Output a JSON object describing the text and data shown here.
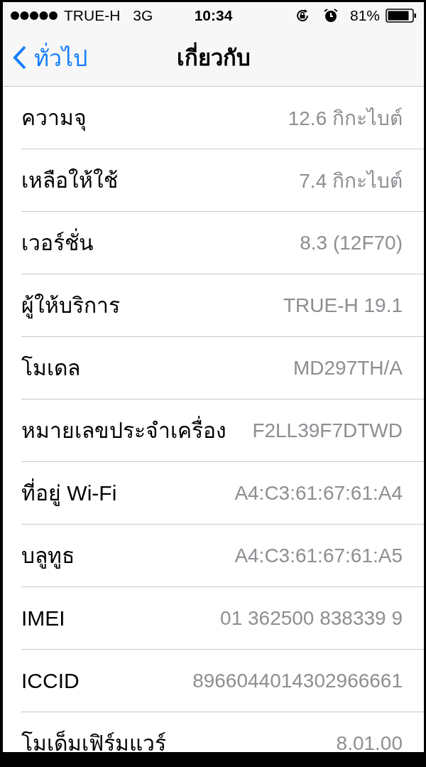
{
  "status_bar": {
    "carrier": "TRUE-H",
    "network": "3G",
    "time": "10:34",
    "battery": "81%"
  },
  "nav_bar": {
    "back": "ทั่วไป",
    "title": "เกี่ยวกับ"
  },
  "rows": [
    {
      "label": "ความจุ",
      "value": "12.6 กิกะไบต์"
    },
    {
      "label": "เหลือให้ใช้",
      "value": "7.4 กิกะไบต์"
    },
    {
      "label": "เวอร์ชั่น",
      "value": "8.3 (12F70)"
    },
    {
      "label": "ผู้ให้บริการ",
      "value": "TRUE-H 19.1"
    },
    {
      "label": "โมเดล",
      "value": "MD297TH/A"
    },
    {
      "label": "หมายเลขประจำเครื่อง",
      "value": "F2LL39F7DTWD"
    },
    {
      "label": "ที่อยู่ Wi-Fi",
      "value": "A4:C3:61:67:61:A4"
    },
    {
      "label": "บลูทูธ",
      "value": "A4:C3:61:67:61:A5"
    },
    {
      "label": "IMEI",
      "value": "01 362500 838339 9"
    },
    {
      "label": "ICCID",
      "value": "8966044014302966661"
    },
    {
      "label": "โมเด็มเฟิร์มแวร์",
      "value": "8.01.00"
    }
  ]
}
